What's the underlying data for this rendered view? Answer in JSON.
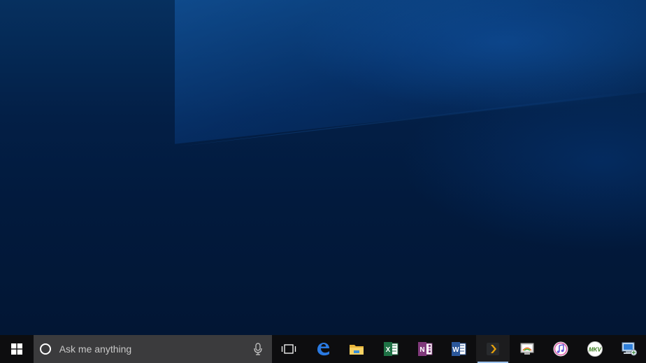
{
  "desktop": {
    "wallpaper_color": "#021a3d",
    "accent_color": "#145aaa"
  },
  "taskbar": {
    "start_icon": "windows-logo-icon",
    "search": {
      "placeholder": "Ask me anything",
      "icon": "cortana-ring-icon",
      "mic_icon": "microphone-icon"
    },
    "task_view_icon": "task-view-icon",
    "apps": [
      {
        "name": "Microsoft Edge",
        "icon": "edge-icon",
        "color": "#1f6fd1",
        "glyph": "e"
      },
      {
        "name": "File Explorer",
        "icon": "folder-icon",
        "color": "#f0c24a",
        "glyph": ""
      },
      {
        "name": "Excel",
        "icon": "excel-icon",
        "color": "#1e7145",
        "glyph": "X"
      },
      {
        "name": "OneNote",
        "icon": "onenote-icon",
        "color": "#80397b",
        "glyph": "N"
      },
      {
        "name": "Word",
        "icon": "word-icon",
        "color": "#2b579a",
        "glyph": "W"
      },
      {
        "name": "Plex",
        "icon": "plex-icon",
        "color": "#e5a00d",
        "glyph": "❯",
        "active": true
      },
      {
        "name": "Remote Desktop",
        "icon": "remote-desktop-icon",
        "color": "#4a90d9",
        "glyph": ""
      },
      {
        "name": "iTunes",
        "icon": "itunes-icon",
        "color": "#e040a0",
        "glyph": "♪"
      },
      {
        "name": "MKV Tool",
        "icon": "mkv-icon",
        "color": "#7cc242",
        "glyph": "MKV"
      },
      {
        "name": "Network",
        "icon": "network-computer-icon",
        "color": "#3c8ce6",
        "glyph": ""
      }
    ]
  }
}
